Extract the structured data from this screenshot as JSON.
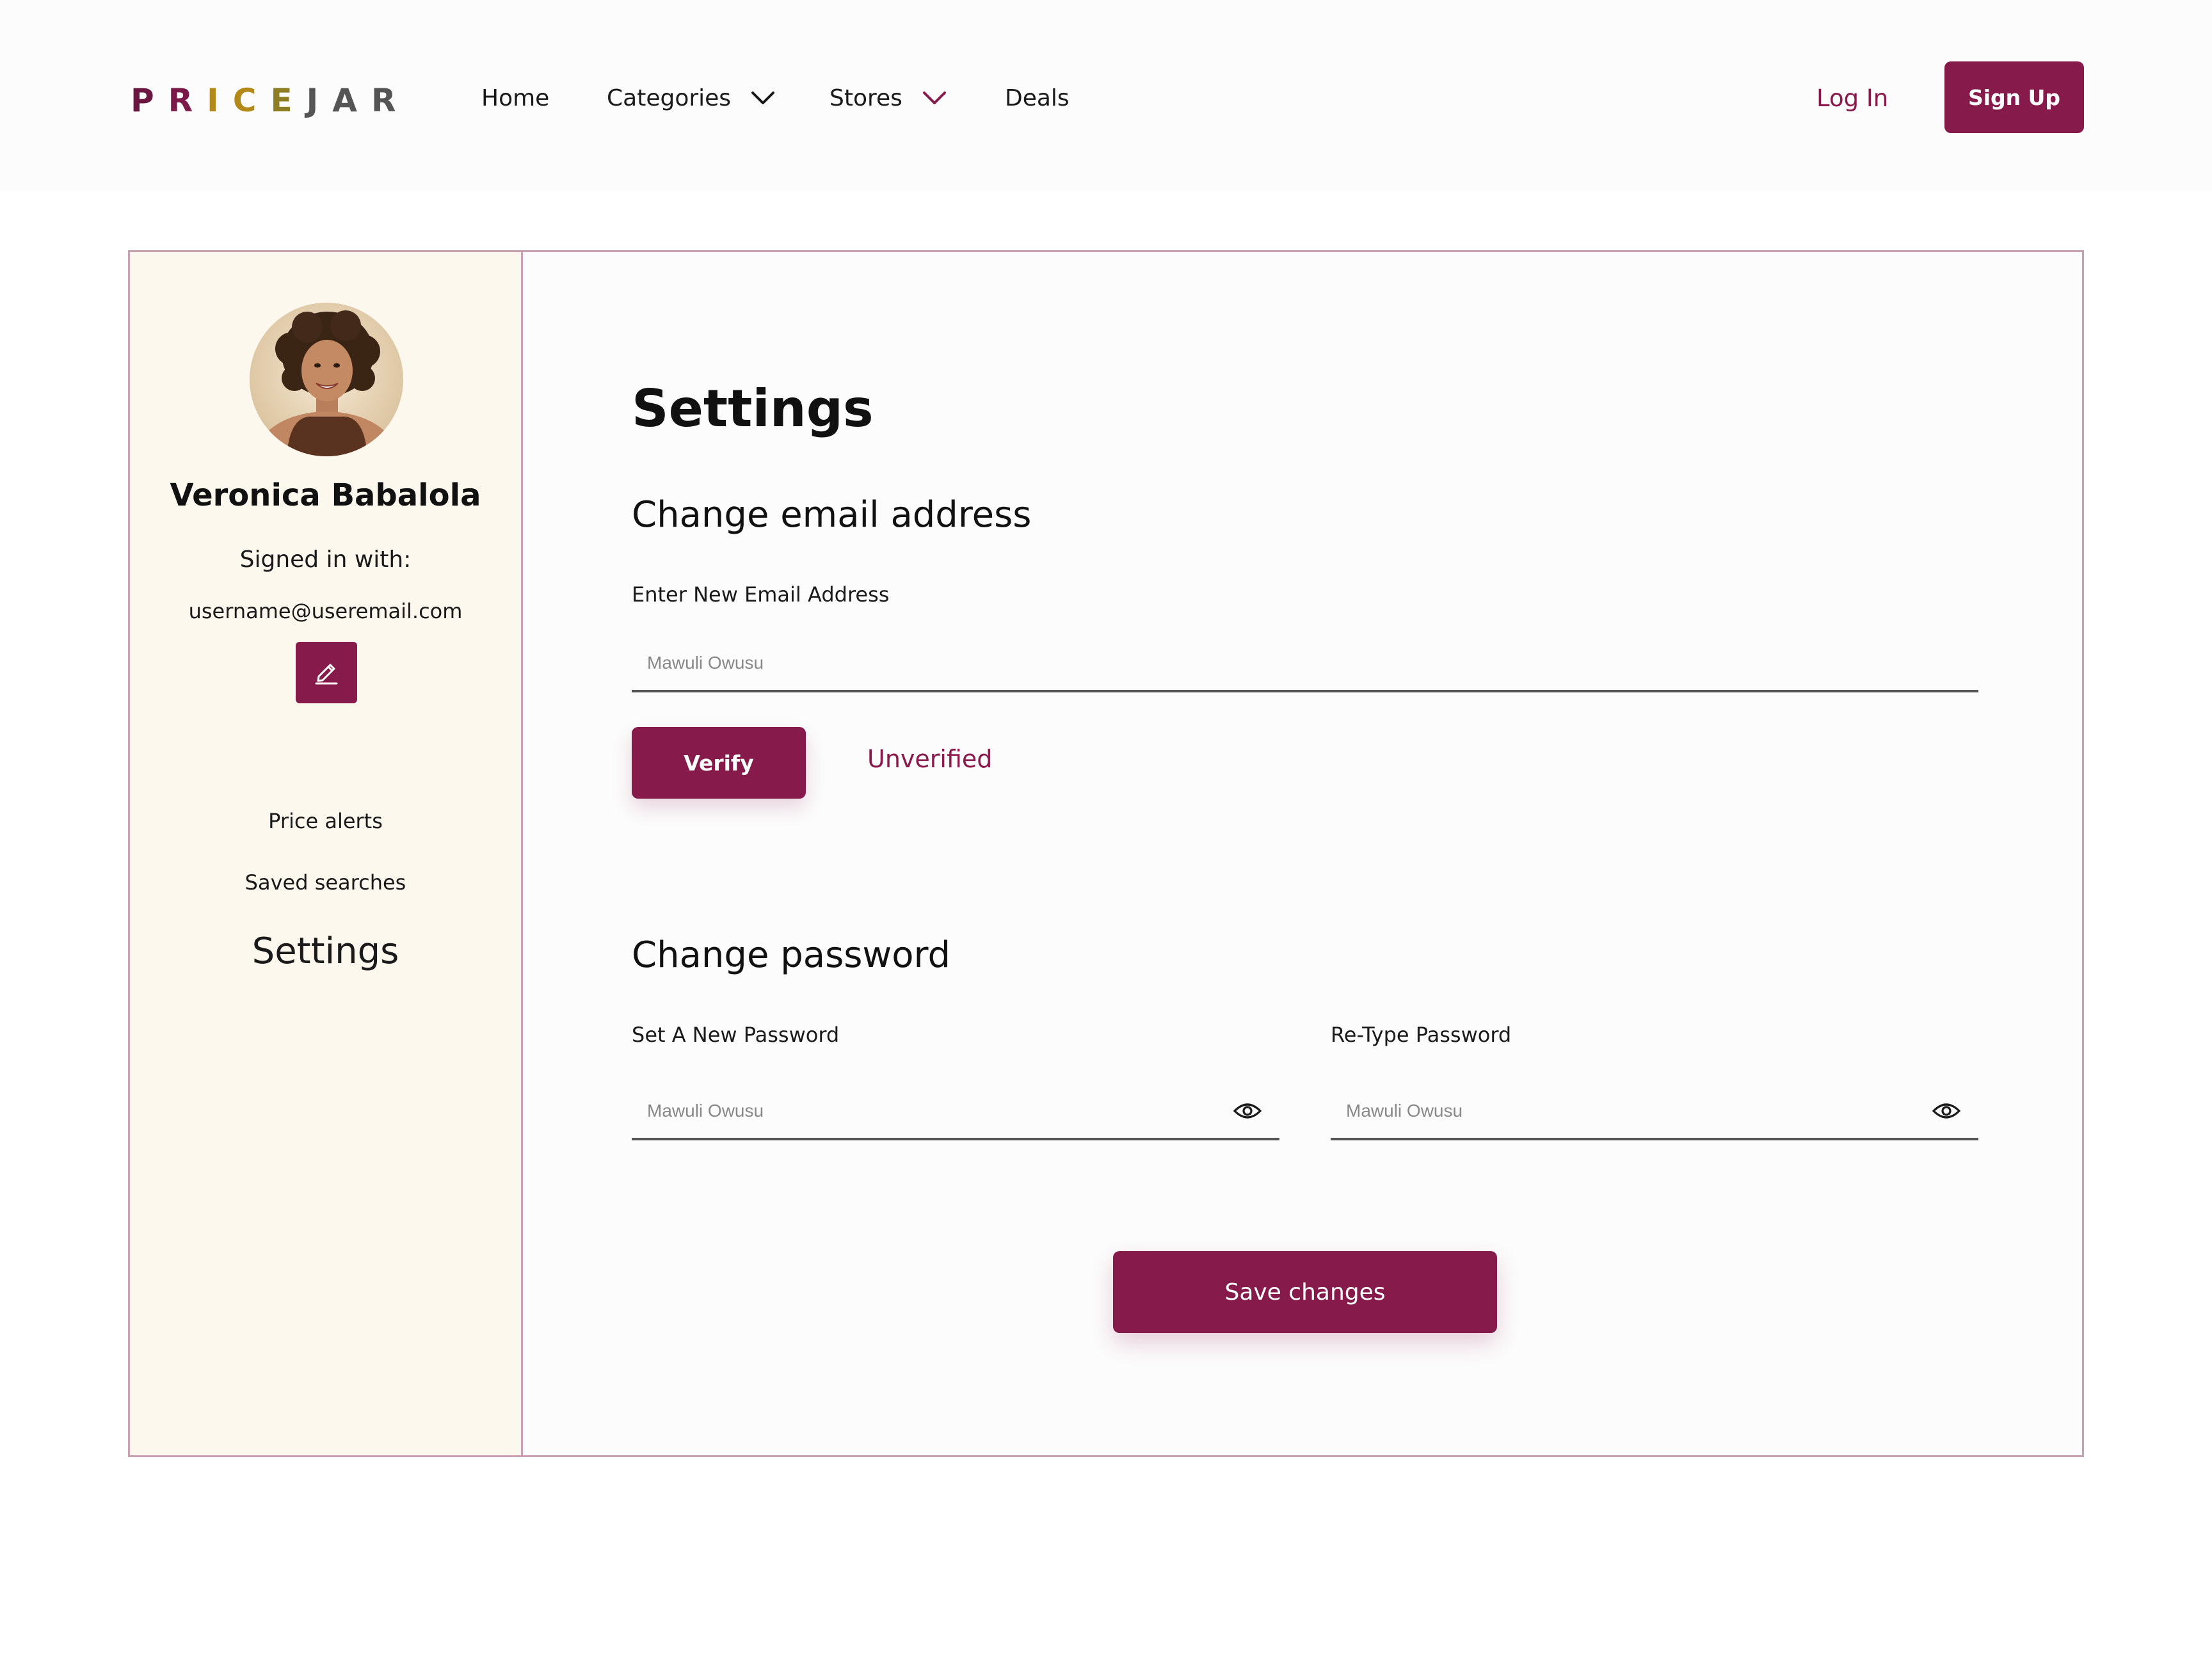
{
  "brand": {
    "letters": [
      "P",
      "R",
      "I",
      "C",
      "E",
      "J",
      "A",
      "R"
    ],
    "letter_colors": [
      "#6b1640",
      "#7a1a48",
      "#b38a1a",
      "#b38a1a",
      "#8f7d24",
      "#555555",
      "#555555",
      "#555555"
    ]
  },
  "nav": {
    "home": "Home",
    "categories": "Categories",
    "stores": "Stores",
    "deals": "Deals",
    "login": "Log In",
    "signup": "Sign Up"
  },
  "profile": {
    "name": "Veronica Babalola",
    "signed_in_label": "Signed in with:",
    "email": "username@useremail.com"
  },
  "sidebar": {
    "price_alerts": "Price alerts",
    "saved_searches": "Saved searches",
    "settings": "Settings"
  },
  "main": {
    "title": "Settings",
    "email_section": {
      "heading": "Change email address",
      "label": "Enter New Email Address",
      "placeholder": "Mawuli Owusu",
      "verify_label": "Verify",
      "status": "Unverified"
    },
    "password_section": {
      "heading": "Change password",
      "new_label": "Set A New Password",
      "new_placeholder": "Mawuli Owusu",
      "retype_label": "Re-Type Password",
      "retype_placeholder": "Mawuli Owusu"
    },
    "save_label": "Save changes"
  },
  "colors": {
    "accent": "#861a4b",
    "sidebar_bg": "#fdf8ee",
    "border": "#c9a0b1"
  },
  "icons": [
    "chevron-down-icon",
    "edit-pencil-icon",
    "eye-icon"
  ]
}
